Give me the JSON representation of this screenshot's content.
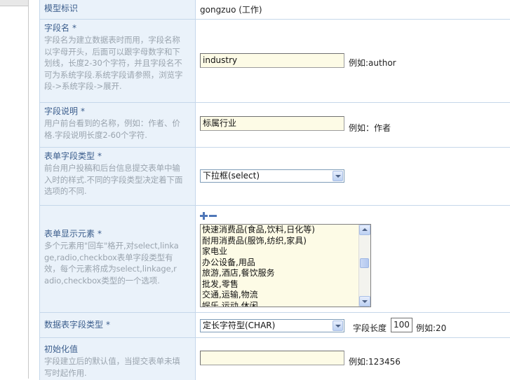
{
  "rows": {
    "model_id": {
      "label": "模型标识",
      "value": "gongzuo (工作)"
    },
    "field_name": {
      "label": "字段名",
      "required_mark": "*",
      "desc": [
        "字段名为建立数据表时而用，字段名称",
        "以字母开头，后面可以跟字母数字和下",
        "划线，长度2-30个字符，并且字段名不",
        "可为系统字段.系统字段请参照，浏览字",
        "段->系统字段->展开."
      ],
      "input_value": "industry",
      "example": "例如:author"
    },
    "field_desc": {
      "label": "字段说明",
      "required_mark": "*",
      "desc": [
        "用户前台看到的名称，例如：作者、价",
        "格.字段说明长度2-60个字符."
      ],
      "input_value": "标属行业",
      "example": "例如：作者"
    },
    "form_field_type": {
      "label": "表单字段类型",
      "required_mark": "*",
      "desc": [
        "前台用户投稿和后台信息提交表单中输",
        "入时的样式.不同的字段类型决定着下面",
        "选项的不同."
      ],
      "selected": "下拉框(select)"
    },
    "form_display_elements": {
      "label": "表单显示元素",
      "required_mark": "*",
      "desc": [
        "多个元素用\"回车\"格开,对select,linka",
        "ge,radio,checkbox表单字段类型有",
        "效，每个元素将成为select,linkage,r",
        "adio,checkbox类型的一个选项."
      ],
      "options": [
        "快速消费品(食品,饮料,日化等)",
        "耐用消费品(服饰,纺织,家具)",
        "家电业",
        "办公设备,用品",
        "旅游,酒店,餐饮服务",
        "批发,零售",
        "交通,运输,物流",
        "娱乐,运动,休闲"
      ]
    },
    "db_field_type": {
      "label": "数据表字段类型",
      "required_mark": "*",
      "selected": "定长字符型(CHAR)",
      "length_label": "字段长度",
      "length_value": "100",
      "example": "例如:20"
    },
    "init_value": {
      "label": "初始化值",
      "desc": [
        "字段建立后的默认值，当提交表单未填",
        "写时起作用."
      ],
      "input_value": "",
      "example": "例如:123456"
    }
  }
}
